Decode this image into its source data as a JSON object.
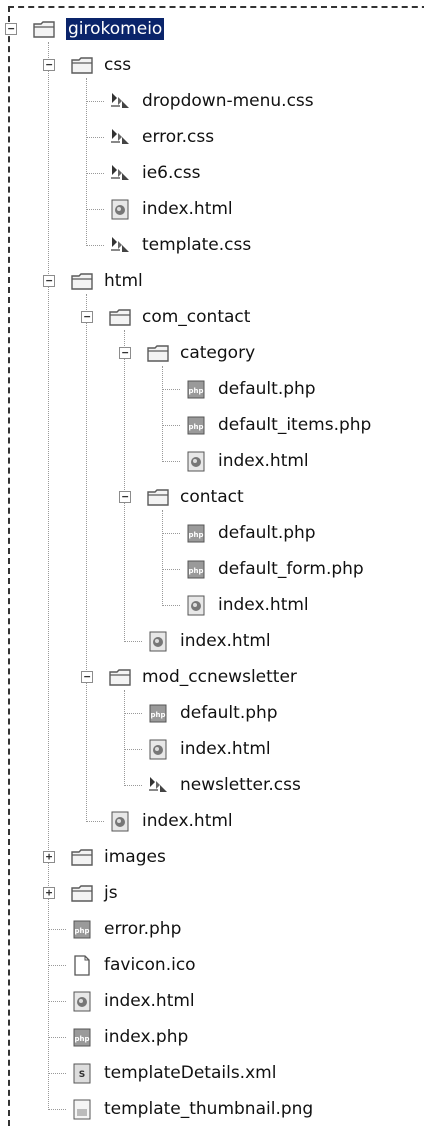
{
  "tree": [
    {
      "label": "girokomeio",
      "type": "folder",
      "depth": 0,
      "expanded": true,
      "selected": true
    },
    {
      "label": "css",
      "type": "folder",
      "depth": 1,
      "expanded": true
    },
    {
      "label": "dropdown-menu.css",
      "type": "css",
      "depth": 2
    },
    {
      "label": "error.css",
      "type": "css",
      "depth": 2
    },
    {
      "label": "ie6.css",
      "type": "css",
      "depth": 2
    },
    {
      "label": "index.html",
      "type": "html",
      "depth": 2
    },
    {
      "label": "template.css",
      "type": "css",
      "depth": 2
    },
    {
      "label": "html",
      "type": "folder",
      "depth": 1,
      "expanded": true
    },
    {
      "label": "com_contact",
      "type": "folder",
      "depth": 2,
      "expanded": true
    },
    {
      "label": "category",
      "type": "folder",
      "depth": 3,
      "expanded": true
    },
    {
      "label": "default.php",
      "type": "php",
      "depth": 4
    },
    {
      "label": "default_items.php",
      "type": "php",
      "depth": 4
    },
    {
      "label": "index.html",
      "type": "html",
      "depth": 4
    },
    {
      "label": "contact",
      "type": "folder",
      "depth": 3,
      "expanded": true
    },
    {
      "label": "default.php",
      "type": "php",
      "depth": 4
    },
    {
      "label": "default_form.php",
      "type": "php",
      "depth": 4
    },
    {
      "label": "index.html",
      "type": "html",
      "depth": 4
    },
    {
      "label": "index.html",
      "type": "html",
      "depth": 3
    },
    {
      "label": "mod_ccnewsletter",
      "type": "folder",
      "depth": 2,
      "expanded": true
    },
    {
      "label": "default.php",
      "type": "php",
      "depth": 3
    },
    {
      "label": "index.html",
      "type": "html",
      "depth": 3
    },
    {
      "label": "newsletter.css",
      "type": "css",
      "depth": 3
    },
    {
      "label": "index.html",
      "type": "html",
      "depth": 2
    },
    {
      "label": "images",
      "type": "folder",
      "depth": 1,
      "expanded": false
    },
    {
      "label": "js",
      "type": "folder",
      "depth": 1,
      "expanded": false
    },
    {
      "label": "error.php",
      "type": "php",
      "depth": 1
    },
    {
      "label": "favicon.ico",
      "type": "ico",
      "depth": 1
    },
    {
      "label": "index.html",
      "type": "html",
      "depth": 1
    },
    {
      "label": "index.php",
      "type": "php",
      "depth": 1
    },
    {
      "label": "templateDetails.xml",
      "type": "xml",
      "depth": 1
    },
    {
      "label": "template_thumbnail.png",
      "type": "png",
      "depth": 1
    }
  ]
}
